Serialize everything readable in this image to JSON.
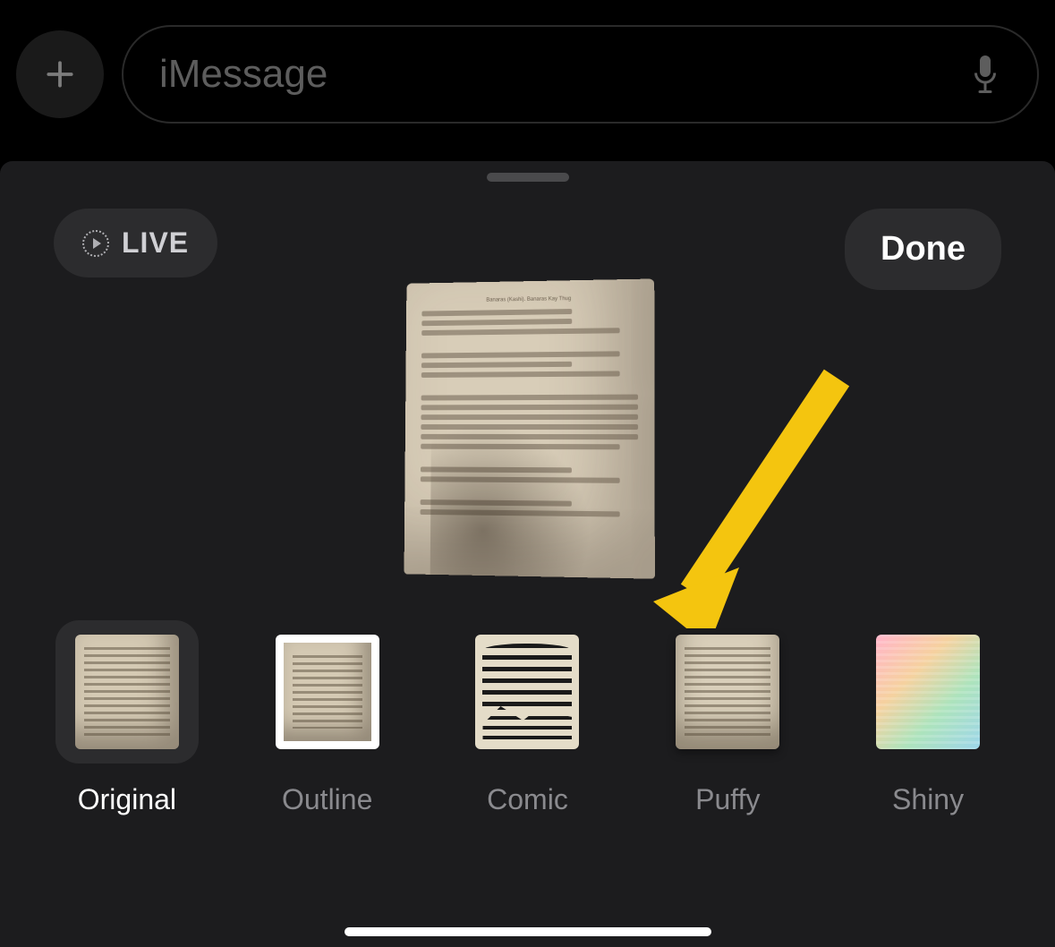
{
  "compose": {
    "placeholder": "iMessage"
  },
  "sheet": {
    "live_label": "LIVE",
    "done_label": "Done"
  },
  "effects": [
    {
      "id": "original",
      "label": "Original",
      "selected": true
    },
    {
      "id": "outline",
      "label": "Outline",
      "selected": false
    },
    {
      "id": "comic",
      "label": "Comic",
      "selected": false
    },
    {
      "id": "puffy",
      "label": "Puffy",
      "selected": false
    },
    {
      "id": "shiny",
      "label": "Shiny",
      "selected": false
    }
  ],
  "annotation": {
    "arrow_color": "#f4c50f",
    "arrow_target_effect": "puffy"
  }
}
